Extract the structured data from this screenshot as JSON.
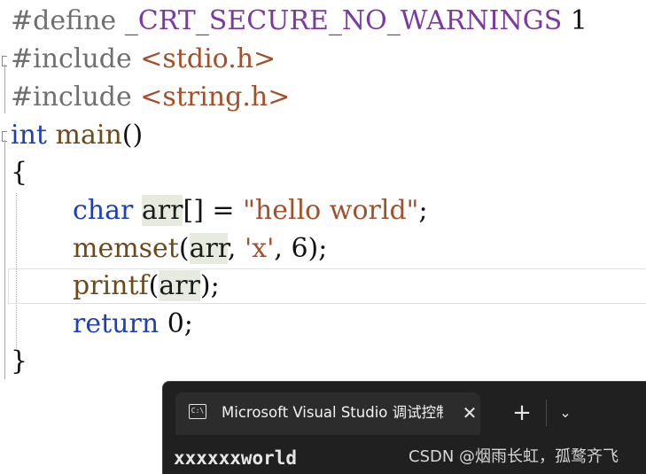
{
  "editor": {
    "lines": {
      "l1": {
        "directive": "#define",
        "macro": "_CRT_SECURE_NO_WARNINGS",
        "value": "1"
      },
      "l2": {
        "directive": "#include",
        "header": "<stdio.h>"
      },
      "l3": {
        "directive": "#include",
        "header": "<string.h>"
      },
      "l4": {
        "type": "int",
        "name": "main",
        "parens": "()"
      },
      "l5": {
        "brace": "{"
      },
      "l6": {
        "type": "char",
        "var": "arr",
        "rest": "[] = ",
        "string": "\"hello world\"",
        "end": ";"
      },
      "l7": {
        "func": "memset",
        "open": "(",
        "arg1": "arr",
        "sep1": ", ",
        "char": "'x'",
        "sep2": ", ",
        "num": "6",
        "close": ");"
      },
      "l8": {
        "func": "printf",
        "open": "(",
        "arg1": "arr",
        "close": ");"
      },
      "l9": {
        "keyword": "return",
        "space": " ",
        "num": "0",
        "end": ";"
      },
      "l10": {
        "brace": "}"
      }
    }
  },
  "console": {
    "tab_title": "Microsoft Visual Studio 调试控制台",
    "icon": "terminal-icon",
    "icon_glyph": "C:\\",
    "close_glyph": "✕",
    "new_tab_glyph": "+",
    "dropdown_glyph": "⌄",
    "output": "xxxxxxworld"
  },
  "watermark": "CSDN @烟雨长虹，孤鹜齐飞"
}
